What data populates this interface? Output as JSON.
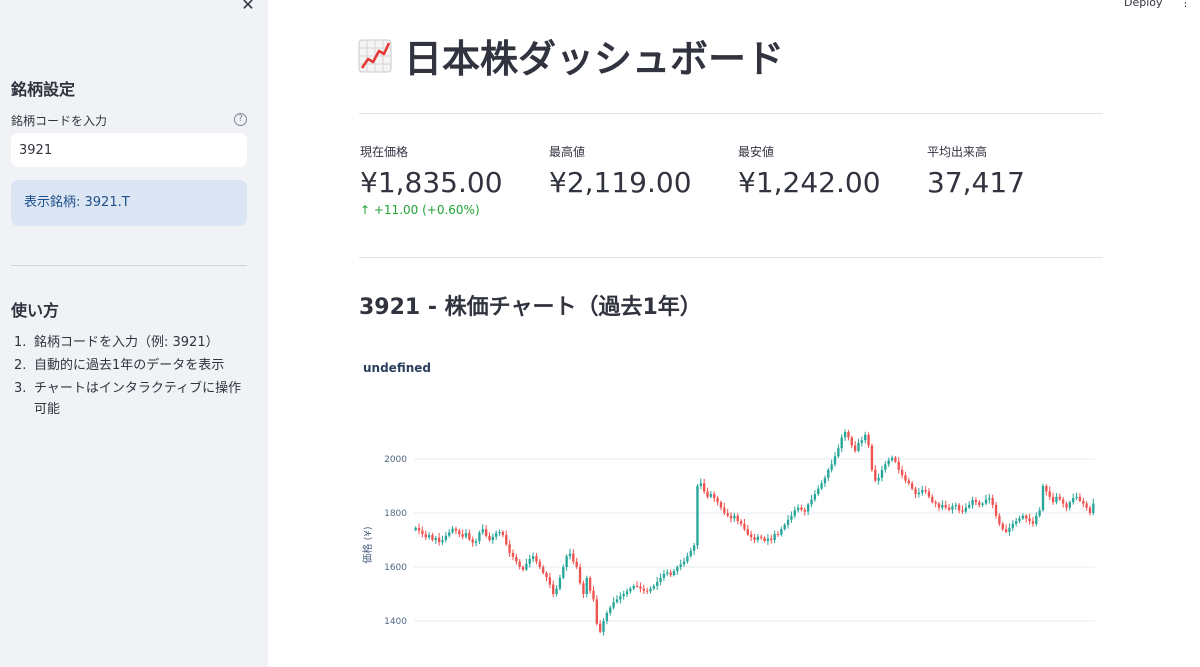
{
  "sidebar": {
    "close_label": "✕",
    "header": "銘柄設定",
    "input_label": "銘柄コードを入力",
    "help_icon": "?",
    "input_value": "3921",
    "info": "表示銘柄: 3921.T",
    "howto_header": "使い方",
    "howto": [
      {
        "num": "1.",
        "text": "銘柄コードを入力（例: 3921）"
      },
      {
        "num": "2.",
        "text": "自動的に過去1年のデータを表示"
      },
      {
        "num": "3.",
        "text": "チャートはインタラクティブに操作可能"
      }
    ]
  },
  "topbar": {
    "deploy": "Deploy",
    "menu": "⋮"
  },
  "title": "日本株ダッシュボード",
  "metrics": [
    {
      "label": "現在価格",
      "value": "¥1,835.00",
      "delta": "↑ +11.00 (+0.60%)"
    },
    {
      "label": "最高値",
      "value": "¥2,119.00"
    },
    {
      "label": "最安値",
      "value": "¥1,242.00"
    },
    {
      "label": "平均出来高",
      "value": "37,417"
    }
  ],
  "chart_heading": "3921 - 株価チャート（過去1年）",
  "chart_data": {
    "type": "candlestick",
    "title": "undefined",
    "ylabel": "価格 (¥)",
    "ylim": [
      1330,
      2160
    ],
    "yticks": [
      1400,
      1600,
      1800,
      2000
    ],
    "colors": {
      "up": "#26a69a",
      "down": "#ef5350",
      "grid": "#e8ebf2"
    },
    "closes": [
      1745,
      1735,
      1722,
      1710,
      1718,
      1700,
      1708,
      1692,
      1700,
      1716,
      1728,
      1742,
      1735,
      1722,
      1712,
      1726,
      1702,
      1690,
      1696,
      1728,
      1740,
      1715,
      1700,
      1712,
      1725,
      1730,
      1718,
      1684,
      1652,
      1638,
      1620,
      1600,
      1590,
      1612,
      1630,
      1640,
      1620,
      1600,
      1578,
      1562,
      1535,
      1500,
      1520,
      1560,
      1600,
      1640,
      1650,
      1620,
      1600,
      1540,
      1500,
      1560,
      1512,
      1480,
      1390,
      1360,
      1400,
      1430,
      1450,
      1470,
      1480,
      1492,
      1500,
      1510,
      1520,
      1530,
      1528,
      1520,
      1512,
      1510,
      1520,
      1530,
      1545,
      1560,
      1575,
      1580,
      1570,
      1585,
      1600,
      1610,
      1620,
      1640,
      1660,
      1680,
      1900,
      1910,
      1880,
      1860,
      1870,
      1855,
      1840,
      1820,
      1800,
      1790,
      1780,
      1790,
      1770,
      1760,
      1740,
      1720,
      1710,
      1700,
      1712,
      1708,
      1696,
      1705,
      1700,
      1722,
      1720,
      1740,
      1756,
      1775,
      1790,
      1810,
      1820,
      1812,
      1805,
      1832,
      1850,
      1870,
      1890,
      1910,
      1930,
      1960,
      1980,
      2010,
      2040,
      2080,
      2100,
      2080,
      2050,
      2030,
      2060,
      2070,
      2090,
      2050,
      1960,
      1920,
      1930,
      1960,
      1980,
      1995,
      2005,
      1990,
      1960,
      1940,
      1920,
      1910,
      1890,
      1870,
      1875,
      1885,
      1880,
      1860,
      1840,
      1835,
      1820,
      1830,
      1820,
      1812,
      1825,
      1830,
      1810,
      1805,
      1820,
      1830,
      1848,
      1840,
      1830,
      1835,
      1850,
      1855,
      1830,
      1790,
      1760,
      1740,
      1730,
      1745,
      1760,
      1770,
      1780,
      1790,
      1780,
      1770,
      1760,
      1790,
      1810,
      1900,
      1880,
      1860,
      1840,
      1860,
      1850,
      1835,
      1820,
      1840,
      1855,
      1860,
      1845,
      1835,
      1820,
      1800,
      1835
    ]
  }
}
